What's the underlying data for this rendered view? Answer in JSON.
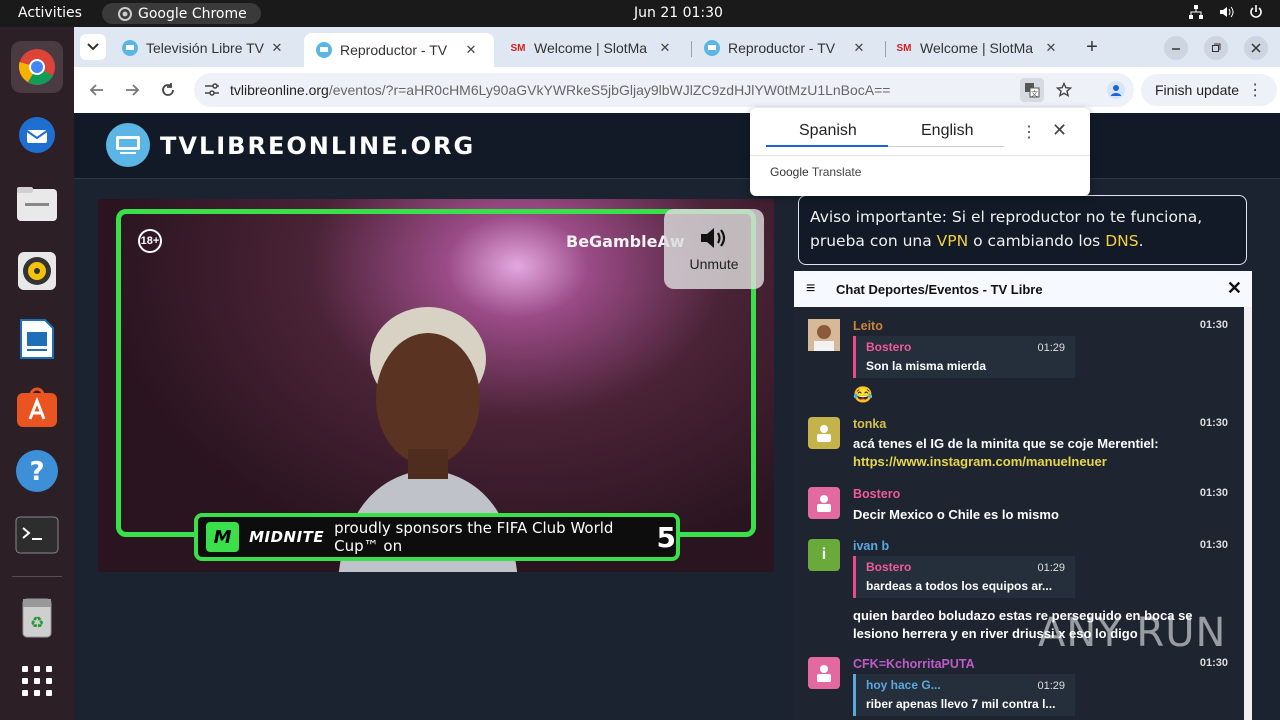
{
  "topbar": {
    "activities": "Activities",
    "app_name": "Google Chrome",
    "clock": "Jun 21  01:30",
    "tray_icons": [
      "network-icon",
      "volume-icon",
      "power-icon"
    ]
  },
  "dock": {
    "items": [
      "chrome-icon",
      "thunderbird-icon",
      "files-icon",
      "rhythmbox-icon",
      "writer-icon",
      "appcenter-icon",
      "help-icon",
      "terminal-icon",
      "trash-icon",
      "app-grid-icon"
    ]
  },
  "browser": {
    "tabs": [
      {
        "title": "Televisión Libre TV",
        "favicon": "tv-icon",
        "active": false
      },
      {
        "title": "Reproductor - TV",
        "favicon": "tv-icon",
        "active": true
      },
      {
        "title": "Welcome | SlotMa",
        "favicon": "slotmate-icon",
        "active": false
      },
      {
        "title": "Reproductor - TV",
        "favicon": "tv-icon",
        "active": false
      },
      {
        "title": "Welcome | SlotMa",
        "favicon": "slotmate-icon",
        "active": false
      }
    ],
    "new_tab": "+",
    "url_host": "tvlibreonline.org",
    "url_path": "/eventos/?r=aHR0cHM6Ly90aGVkYWRkeS5jbGljay9lbWJlZC9zdHJlYW0tMzU1LnBocA==",
    "finish_update": "Finish update"
  },
  "translate_popup": {
    "lang_from": "Spanish",
    "lang_to": "English",
    "google": "Google",
    "translate": "Translate"
  },
  "site": {
    "logo_text": "TVLIBREONLINE.ORG",
    "notice_pre": "Aviso importante: Si el reproductor no te funciona, prueba con una ",
    "notice_vpn": "VPN",
    "notice_mid": " o cambiando los ",
    "notice_dns": "DNS",
    "notice_end": "."
  },
  "player": {
    "age_badge": "18+",
    "overlay_brand": "BeGambleAw",
    "unmute_label": "Unmute",
    "sponsor_brand": "MIDNITE",
    "sponsor_text": "proudly sponsors the FIFA Club World Cup™ on",
    "sponsor_channel": "5"
  },
  "chat": {
    "title": "Chat Deportes/Eventos - TV Libre",
    "messages": [
      {
        "name": "Leito",
        "time": "01:30",
        "quote_name": "Bostero",
        "quote_time": "01:29",
        "quote_text": "Son la misma mierda",
        "text": "😂"
      },
      {
        "name": "tonka",
        "time": "01:30",
        "text": "acá tenes el IG de la minita que se coje Merentiel:",
        "link": "https://www.instagram.com/manuelneuer"
      },
      {
        "name": "Bostero",
        "time": "01:30",
        "text": "Decir Mexico o Chile es lo mismo"
      },
      {
        "name": "ivan b",
        "time": "01:30",
        "avatar_letter": "i",
        "quote_name": "Bostero",
        "quote_time": "01:29",
        "quote_text": "bardeas a todos los equipos ar...",
        "text": "quien bardeo boludazo estas re perseguido en boca se lesiono herrera y en river driussi x eso lo digo"
      },
      {
        "name": "CFK=KchorritaPUTA",
        "time": "01:30",
        "quote_name": "hoy hace G...",
        "quote_time": "01:29",
        "quote_text": "riber apenas llevo 7 mil contra l..."
      }
    ]
  },
  "watermark": "ANY RUN",
  "colors": {
    "accent_green": "#39e04a",
    "link_yellow": "#e8d64a",
    "page_bg": "#1b2330"
  }
}
